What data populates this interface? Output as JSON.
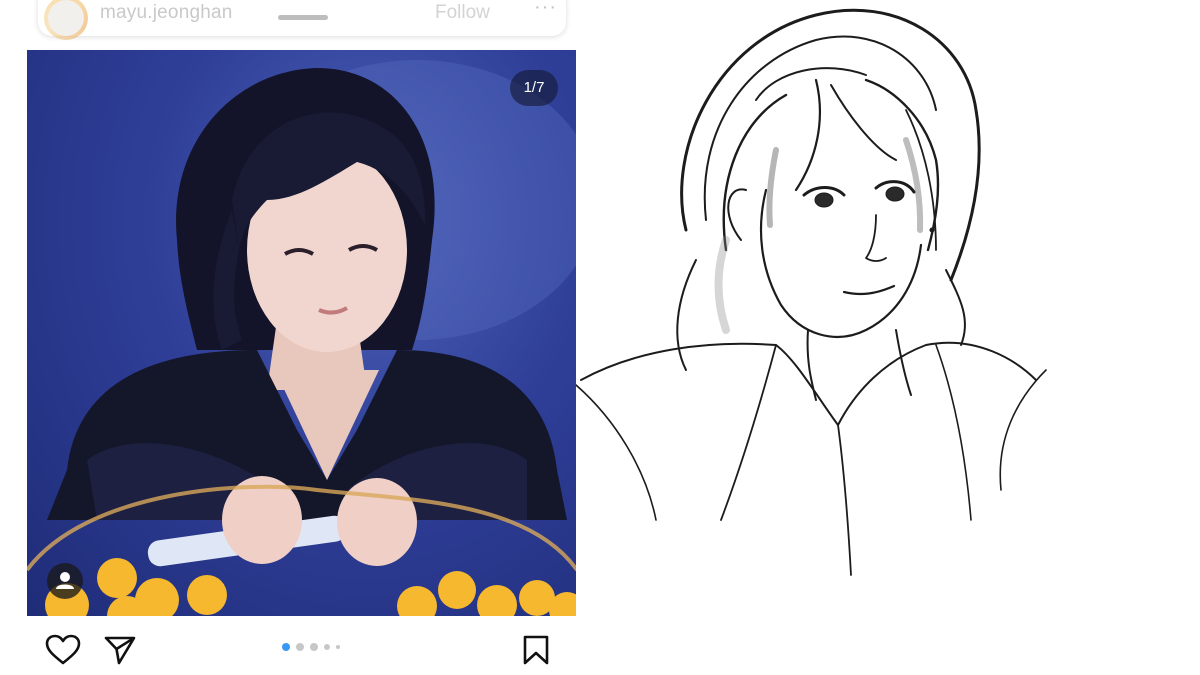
{
  "post": {
    "username": "mayu.jeonghan",
    "follow_label": "Follow",
    "more_label": "···",
    "image_counter": "1/7",
    "carousel": {
      "total_dots": 5,
      "active_index": 0
    }
  },
  "colors": {
    "photo_bg": "#2f3f98",
    "counter_bg": "#1a1e3a",
    "active_dot": "#3897f0",
    "inactive_dot": "#c7c7c7",
    "icon_stroke": "#111111"
  },
  "icons": {
    "like": "heart-icon",
    "share": "paper-plane-icon",
    "save": "bookmark-icon",
    "user_tag": "person-icon",
    "more": "ellipsis-icon"
  }
}
